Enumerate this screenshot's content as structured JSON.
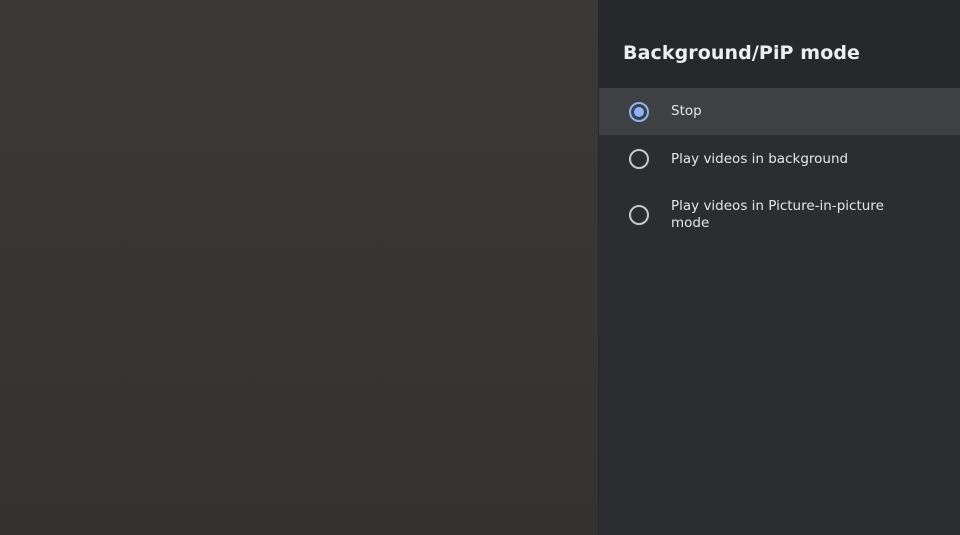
{
  "panel": {
    "title": "Background/PiP mode",
    "options": [
      {
        "label": "Stop",
        "selected": true,
        "focused": true
      },
      {
        "label": "Play videos in background",
        "selected": false,
        "focused": false
      },
      {
        "label": "Play videos in Picture-in-picture mode",
        "selected": false,
        "focused": false
      }
    ]
  },
  "colors": {
    "accent": "#8ab4f8",
    "panel_background": "#2c2d30",
    "header_background": "#27282b",
    "focused_row": "#3e4043",
    "backdrop": "#373533"
  },
  "icons": {
    "selected": "radio-checked-icon",
    "unselected": "radio-unchecked-icon"
  }
}
